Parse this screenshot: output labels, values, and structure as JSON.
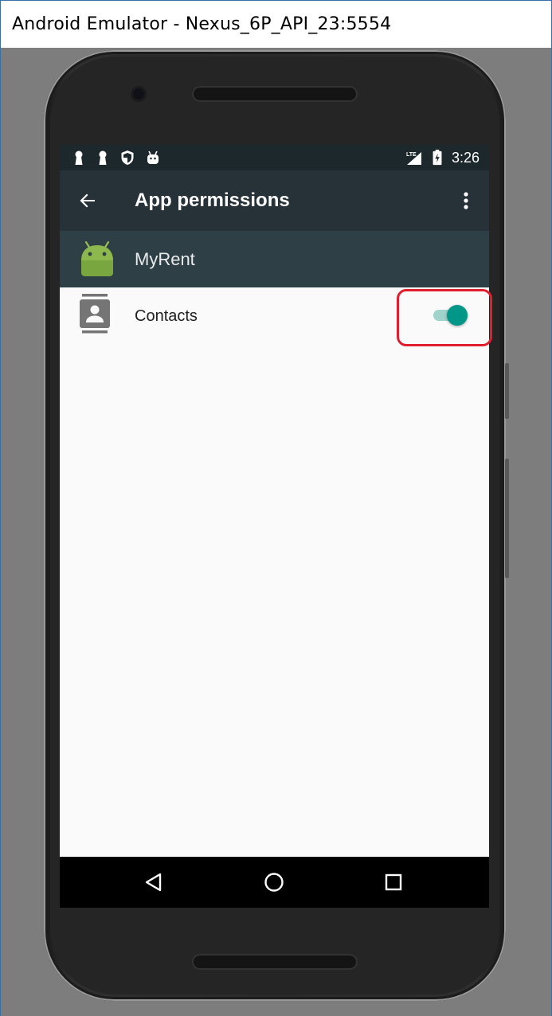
{
  "window": {
    "title": "Android Emulator - Nexus_6P_API_23:5554"
  },
  "statusbar": {
    "time": "3:26",
    "network_label": "LTE",
    "left_icons": [
      "keyhole-icon",
      "keyhole-icon",
      "shield-icon",
      "android-debug-icon"
    ],
    "right_icons": [
      "lte-signal-icon",
      "battery-charging-icon"
    ]
  },
  "toolbar": {
    "title": "App permissions",
    "back_icon": "arrow-back-icon",
    "menu_icon": "more-vert-icon"
  },
  "app_header": {
    "app_name": "MyRent",
    "app_icon": "android-robot-icon"
  },
  "permissions": [
    {
      "label": "Contacts",
      "icon": "contacts-icon",
      "enabled": true
    }
  ],
  "navbar": {
    "icons": [
      "nav-back-icon",
      "nav-home-icon",
      "nav-recents-icon"
    ]
  },
  "colors": {
    "statusbar": "#1d282d",
    "toolbar": "#263238",
    "app_header": "#2f3f46",
    "accent": "#009688",
    "highlight": "#e01e2e"
  }
}
